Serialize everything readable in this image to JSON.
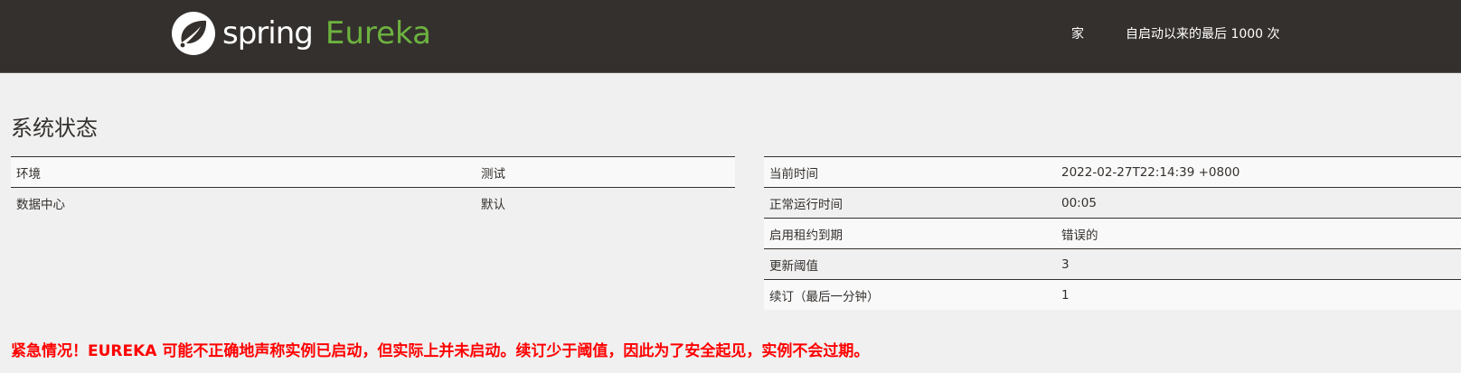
{
  "navbar": {
    "brand_spring": "spring",
    "brand_eureka": "Eureka",
    "links": {
      "home": "家",
      "last_1000": "自启动以来的最后 1000 次"
    },
    "colors": {
      "background": "#34302d",
      "brand_green": "#6db33f"
    }
  },
  "main": {
    "title": "系统状态",
    "left_table": [
      {
        "key": "环境",
        "value": "测试"
      },
      {
        "key": "数据中心",
        "value": "默认"
      }
    ],
    "right_table": [
      {
        "key": "当前时间",
        "value": "2022-02-27T22:14:39 +0800"
      },
      {
        "key": "正常运行时间",
        "value": "00:05"
      },
      {
        "key": "启用租约到期",
        "value": "错误的"
      },
      {
        "key": "更新阈值",
        "value": "3"
      },
      {
        "key": "续订（最后一分钟）",
        "value": "1"
      }
    ],
    "warning": "紧急情况！EUREKA 可能不正确地声称实例已启动，但实际上并未启动。续订少于阈值，因此为了安全起见，实例不会过期。",
    "warning_color": "#ff0000"
  }
}
